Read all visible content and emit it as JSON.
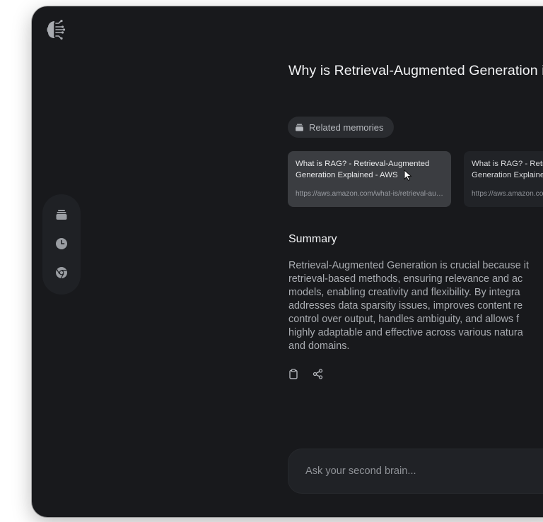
{
  "app": {
    "logo_icon": "brain-circuit-icon"
  },
  "sidebar": {
    "items": [
      {
        "icon": "memories-stack-icon",
        "name": "memories"
      },
      {
        "icon": "clock-icon",
        "name": "history"
      },
      {
        "icon": "chrome-icon",
        "name": "browser"
      }
    ]
  },
  "main": {
    "question": "Why is Retrieval-Augmented Generation important?",
    "related_label": "Related memories",
    "related_icon": "memories-stack-icon",
    "cards": [
      {
        "title": "What is RAG? - Retrieval-Augmented\nGeneration Explained - AWS",
        "url": "https://aws.amazon.com/what-is/retrieval-augmented-generation/"
      },
      {
        "title": "What is RAG? - Retrieval-Augmented\nGeneration Explained",
        "url": "https://aws.amazon.com/what-is/retrieval-augmented-generation/"
      }
    ],
    "summary_heading": "Summary",
    "summary_text": "Retrieval-Augmented Generation is crucial because it\nretrieval-based methods, ensuring relevance and ac\nmodels, enabling creativity and flexibility. By integra\naddresses data sparsity issues, improves content re\ncontrol over output, handles ambiguity, and allows f\nhighly adaptable and effective across various natura\nand domains.",
    "actions": [
      {
        "icon": "clipboard-icon",
        "name": "copy"
      },
      {
        "icon": "share-icon",
        "name": "share"
      }
    ]
  },
  "ask": {
    "placeholder": "Ask your second brain..."
  },
  "colors": {
    "window_bg": "#18191c",
    "rail_bg": "#1f2125",
    "card_active": "#3b3d41",
    "card_idle": "#212327",
    "text_primary": "#f1f2f4",
    "text_muted": "#a9acb1"
  }
}
